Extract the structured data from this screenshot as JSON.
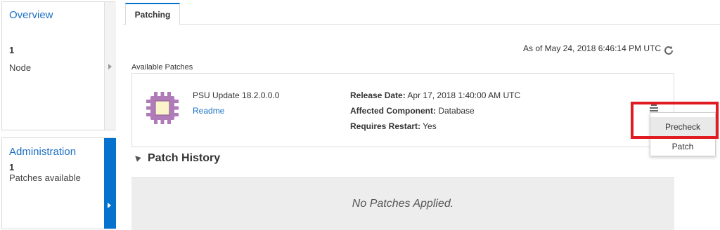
{
  "overview": {
    "title": "Overview",
    "count": "1",
    "label": "Node"
  },
  "administration": {
    "title": "Administration",
    "count": "1",
    "label": "Patches available"
  },
  "tabs": [
    {
      "label": "Patching",
      "active": true
    }
  ],
  "as_of": "As of May 24, 2018 6:46:14 PM UTC",
  "available_patches": {
    "heading": "Available Patches",
    "patch": {
      "name": "PSU Update 18.2.0.0.0",
      "readme_link": "Readme",
      "release_date_label": "Release Date:",
      "release_date_value": "Apr 17, 2018 1:40:00 AM UTC",
      "component_label": "Affected Component:",
      "component_value": "Database",
      "restart_label": "Requires Restart:",
      "restart_value": "Yes"
    }
  },
  "actions_menu": {
    "icon": "hamburger-menu-icon",
    "items": [
      {
        "label": "Precheck"
      },
      {
        "label": "Patch"
      }
    ]
  },
  "patch_history": {
    "title": "Patch History",
    "empty_message": "No Patches Applied."
  },
  "colors": {
    "accent": "#0572ce",
    "link": "#1a6fc4",
    "highlight": "#e01b22",
    "chip": "#b07bb8"
  }
}
